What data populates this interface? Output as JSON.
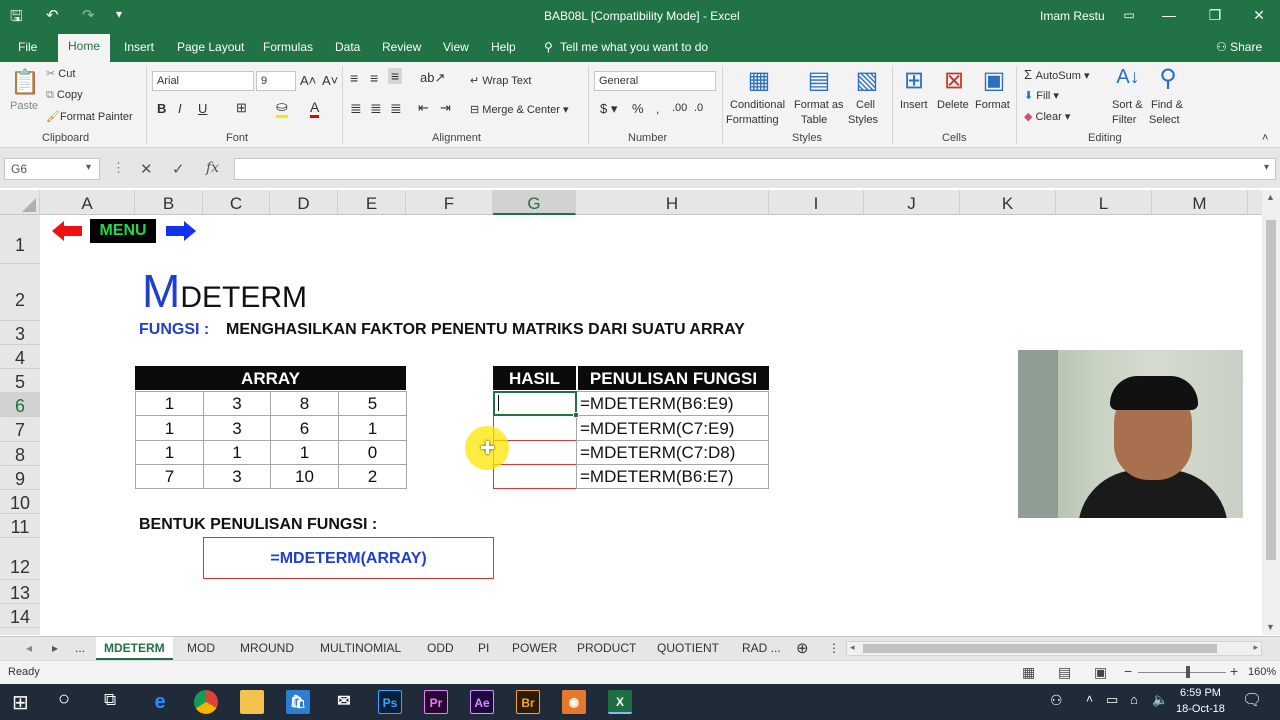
{
  "window": {
    "title": "BAB08L  [Compatibility Mode]  -  Excel",
    "user": "Imam Restu"
  },
  "menu": {
    "tabs": [
      "File",
      "Home",
      "Insert",
      "Page Layout",
      "Formulas",
      "Data",
      "Review",
      "View",
      "Help"
    ],
    "tell_me": "Tell me what you want to do",
    "share": "Share"
  },
  "ribbon": {
    "clipboard": {
      "paste": "Paste",
      "cut": "Cut",
      "copy": "Copy",
      "format_painter": "Format Painter",
      "label": "Clipboard"
    },
    "font": {
      "name": "Arial",
      "size": "9",
      "label": "Font"
    },
    "alignment": {
      "wrap": "Wrap Text",
      "merge": "Merge & Center",
      "label": "Alignment"
    },
    "number": {
      "format": "General",
      "label": "Number"
    },
    "styles": {
      "cond": "Conditional",
      "cond2": "Formatting",
      "fmt_table": "Format as",
      "fmt_table2": "Table",
      "cell_styles": "Cell",
      "cell_styles2": "Styles",
      "label": "Styles"
    },
    "cells": {
      "insert": "Insert",
      "delete": "Delete",
      "format": "Format",
      "label": "Cells"
    },
    "editing": {
      "autosum": "AutoSum",
      "fill": "Fill",
      "clear": "Clear",
      "sort": "Sort &",
      "sort2": "Filter",
      "find": "Find &",
      "find2": "Select",
      "label": "Editing"
    }
  },
  "formula_bar": {
    "name_box": "G6",
    "formula": ""
  },
  "columns": [
    "A",
    "B",
    "C",
    "D",
    "E",
    "F",
    "G",
    "H",
    "I",
    "J",
    "K",
    "L",
    "M"
  ],
  "rows": [
    "1",
    "2",
    "3",
    "4",
    "5",
    "6",
    "7",
    "8",
    "9",
    "10",
    "11",
    "12",
    "13",
    "14"
  ],
  "sheet": {
    "menu_label": "MENU",
    "title_big": "M",
    "title_rest": "DETERM",
    "fungsi_label": "FUNGSI :",
    "fungsi_desc": "MENGHASILKAN FAKTOR PENENTU MATRIKS DARI SUATU ARRAY",
    "array_header": "ARRAY",
    "array": [
      [
        "1",
        "3",
        "8",
        "5"
      ],
      [
        "1",
        "3",
        "6",
        "1"
      ],
      [
        "1",
        "1",
        "1",
        "0"
      ],
      [
        "7",
        "3",
        "10",
        "2"
      ]
    ],
    "hasil_header": "HASIL",
    "penulisan_header": "PENULISAN FUNGSI",
    "formulas": [
      "=MDETERM(B6:E9)",
      "=MDETERM(C7:E9)",
      "=MDETERM(C7:D8)",
      "=MDETERM(B6:E7)"
    ],
    "bentuk_label": "BENTUK PENULISAN FUNGSI :",
    "bentuk_formula": "=MDETERM(ARRAY)"
  },
  "sheet_tabs": [
    "...",
    "MDETERM",
    "MOD",
    "MROUND",
    "MULTINOMIAL",
    "ODD",
    "PI",
    "POWER",
    "PRODUCT",
    "QUOTIENT",
    "RAD ..."
  ],
  "status": {
    "ready": "Ready",
    "zoom": "160%"
  },
  "taskbar": {
    "time": "6:59 PM",
    "date": "18-Oct-18"
  },
  "colors": {
    "excel_green": "#217346",
    "title_blue": "#1f3fcf",
    "menu_green": "#21d84a"
  }
}
